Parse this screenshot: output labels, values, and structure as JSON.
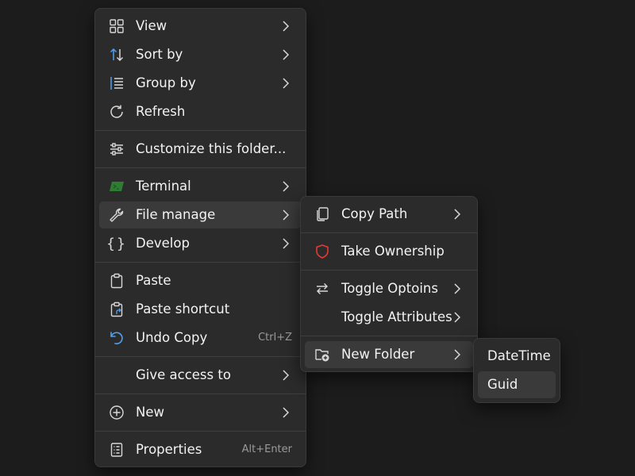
{
  "main_menu": {
    "items": [
      {
        "label": "View",
        "icon": "grid-view-icon",
        "has_submenu": true
      },
      {
        "label": "Sort by",
        "icon": "sort-arrows-icon",
        "has_submenu": true
      },
      {
        "label": "Group by",
        "icon": "group-list-icon",
        "has_submenu": true
      },
      {
        "label": "Refresh",
        "icon": "refresh-icon",
        "has_submenu": false
      },
      {
        "label": "Customize this folder...",
        "icon": "sliders-icon",
        "has_submenu": false
      },
      {
        "label": "Terminal",
        "icon": "terminal-icon",
        "has_submenu": true
      },
      {
        "label": "File manage",
        "icon": "wrench-icon",
        "has_submenu": true,
        "highlighted": true
      },
      {
        "label": "Develop",
        "icon": "braces-icon",
        "has_submenu": true
      },
      {
        "label": "Paste",
        "icon": "clipboard-icon",
        "has_submenu": false
      },
      {
        "label": "Paste shortcut",
        "icon": "clipboard-shortcut-icon",
        "has_submenu": false
      },
      {
        "label": "Undo Copy",
        "icon": "undo-icon",
        "has_submenu": false,
        "shortcut": "Ctrl+Z"
      },
      {
        "label": "Give access to",
        "icon": "",
        "has_submenu": true
      },
      {
        "label": "New",
        "icon": "plus-circle-icon",
        "has_submenu": true
      },
      {
        "label": "Properties",
        "icon": "properties-icon",
        "has_submenu": false,
        "shortcut": "Alt+Enter"
      }
    ]
  },
  "file_manage_menu": {
    "items": [
      {
        "label": "Copy Path",
        "icon": "copy-icon",
        "has_submenu": true
      },
      {
        "label": "Take Ownership",
        "icon": "shield-icon",
        "has_submenu": false
      },
      {
        "label": "Toggle Optoins",
        "icon": "swap-arrows-icon",
        "has_submenu": true
      },
      {
        "label": "Toggle Attributes",
        "icon": "",
        "has_submenu": true
      },
      {
        "label": "New Folder",
        "icon": "new-folder-icon",
        "has_submenu": true,
        "highlighted": true
      }
    ]
  },
  "new_folder_menu": {
    "items": [
      {
        "label": "DateTime"
      },
      {
        "label": "Guid",
        "highlighted": true
      }
    ]
  },
  "colors": {
    "background": "#1c1c1c",
    "menu_bg": "#2b2b2b",
    "highlight": "#3a3a3a",
    "accent_blue": "#4ea2f2",
    "terminal_green": "#2e7d32",
    "shield_red": "#e53935"
  }
}
